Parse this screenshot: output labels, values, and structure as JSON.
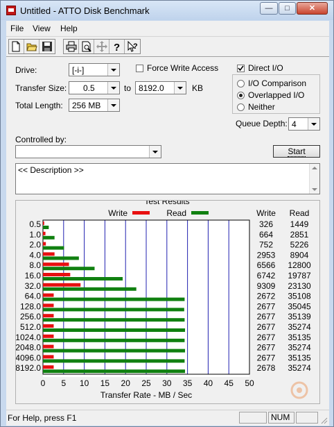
{
  "window": {
    "title": "Untitled - ATTO Disk Benchmark",
    "minimize": "—",
    "maximize": "□",
    "close": "✕"
  },
  "menu": [
    "File",
    "View",
    "Help"
  ],
  "toolbar": {
    "icons": [
      "new-file-icon",
      "open-folder-icon",
      "save-icon",
      "print-icon",
      "print-preview-icon",
      "move-icon",
      "help-icon",
      "context-help-icon"
    ]
  },
  "settings": {
    "drive_label": "Drive:",
    "drive_value": "[-i-]",
    "force_write_label": "Force Write Access",
    "force_write_checked": false,
    "direct_io_label": "Direct I/O",
    "direct_io_checked": true,
    "transfer_size_label": "Transfer Size:",
    "transfer_from": "0.5",
    "to_label": "to",
    "transfer_to": "8192.0",
    "unit_label": "KB",
    "total_length_label": "Total Length:",
    "total_length_value": "256 MB",
    "io_options": [
      {
        "label": "I/O Comparison",
        "selected": false
      },
      {
        "label": "Overlapped I/O",
        "selected": true
      },
      {
        "label": "Neither",
        "selected": false
      }
    ],
    "queue_depth_label": "Queue Depth:",
    "queue_depth_value": "4",
    "controlled_by_label": "Controlled by:",
    "controlled_by_value": "",
    "start_label": "Start",
    "description": "<< Description >>"
  },
  "results": {
    "group_title": "Test Results",
    "legend_write": "Write",
    "legend_read": "Read",
    "col_write": "Write",
    "col_read": "Read"
  },
  "chart_data": {
    "type": "bar",
    "orientation": "horizontal",
    "title": "",
    "xlabel": "Transfer Rate - MB / Sec",
    "ylabel": "",
    "xlim": [
      0,
      50
    ],
    "xticks": [
      0,
      5,
      10,
      15,
      20,
      25,
      30,
      35,
      40,
      45,
      50
    ],
    "categories": [
      "0.5",
      "1.0",
      "2.0",
      "4.0",
      "8.0",
      "16.0",
      "32.0",
      "64.0",
      "128.0",
      "256.0",
      "512.0",
      "1024.0",
      "2048.0",
      "4096.0",
      "8192.0"
    ],
    "series": [
      {
        "name": "Write",
        "color": "#e81010",
        "values": [
          0.3,
          0.6,
          0.7,
          2.8,
          6.3,
          6.6,
          9.1,
          2.6,
          2.6,
          2.6,
          2.6,
          2.6,
          2.6,
          2.6,
          2.6
        ]
      },
      {
        "name": "Read",
        "color": "#108010",
        "values": [
          1.4,
          2.8,
          5.1,
          8.7,
          12.5,
          19.3,
          22.6,
          34.3,
          34.2,
          34.3,
          34.4,
          34.3,
          34.4,
          34.3,
          34.4
        ]
      }
    ],
    "write_kb": [
      "326",
      "664",
      "752",
      "2953",
      "6566",
      "6742",
      "9309",
      "2672",
      "2677",
      "2677",
      "2677",
      "2677",
      "2677",
      "2677",
      "2678"
    ],
    "read_kb": [
      "1449",
      "2851",
      "5226",
      "8904",
      "12800",
      "19787",
      "23130",
      "35108",
      "35045",
      "35139",
      "35274",
      "35135",
      "35274",
      "35135",
      "35274"
    ],
    "grid": true,
    "legend": "top"
  },
  "watermark": "pctuning",
  "status": {
    "text": "For Help, press F1",
    "num": "NUM"
  }
}
